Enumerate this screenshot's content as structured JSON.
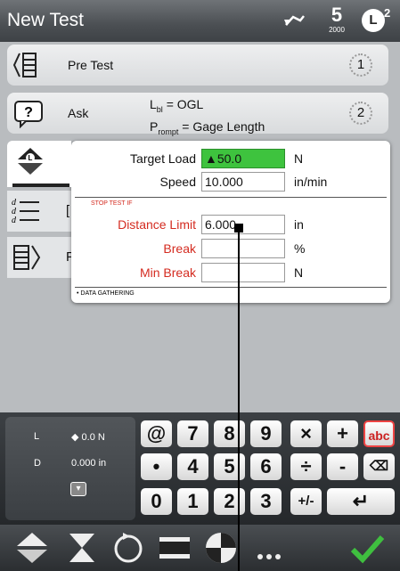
{
  "app": {
    "title": "New Test",
    "header_number_big": "5",
    "header_number_small": "2000",
    "header_badge": "L",
    "header_badge_sup": "2"
  },
  "steps": [
    {
      "name": "Pre Test",
      "number": "1"
    },
    {
      "name": "Ask",
      "number": "2"
    }
  ],
  "ask_formula": {
    "line1_main": "L",
    "line1_sub": "bl",
    "line1_rest": " = OGL",
    "line2_main": "P",
    "line2_sub": "rompt",
    "line2_rest": " = Gage Length"
  },
  "stub_labels": [
    "[",
    "F"
  ],
  "panel": {
    "target_load_label": "Target Load",
    "target_load_value": "50.0",
    "target_load_unit": "N",
    "speed_label": "Speed",
    "speed_value": "10.000",
    "speed_unit": "in/min",
    "stop_section": "STOP TEST IF",
    "distance_limit_label": "Distance Limit",
    "distance_limit_value": "6.000",
    "distance_limit_unit": "in",
    "break_label": "Break",
    "break_value": "",
    "break_unit": "%",
    "min_break_label": "Min Break",
    "min_break_value": "",
    "min_break_unit": "N",
    "data_section": "DATA GATHERING"
  },
  "status": {
    "load_key": "L",
    "load_value": "0.0 N",
    "disp_key": "D",
    "disp_value": "0.000 in"
  },
  "keypad": {
    "row1": [
      "@",
      "7",
      "8",
      "9",
      "×",
      "+",
      "abc"
    ],
    "row2": [
      "•",
      "4",
      "5",
      "6",
      "÷",
      "-",
      "⌫"
    ],
    "row3": [
      "0",
      "1",
      "2",
      "3",
      "+/-",
      "↵"
    ]
  },
  "colors": {
    "accent_green": "#3ec33e",
    "stop_red": "#d42b20",
    "confirm_green": "#3fbf3f"
  },
  "toolbar_icons": [
    "up-down-arrows-icon",
    "hourglass-icon",
    "cycle-icon",
    "block-icon",
    "quadrant-icon",
    "more-icon",
    "checkmark-icon"
  ]
}
